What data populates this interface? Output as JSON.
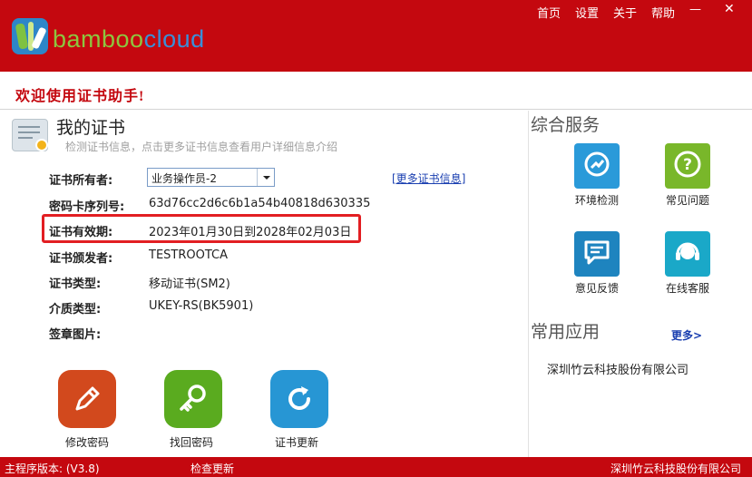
{
  "header": {
    "brand_part1": "bamboo",
    "brand_part2": "cloud",
    "menu": [
      "首页",
      "设置",
      "关于",
      "帮助"
    ],
    "minimize": "—",
    "close": "✕"
  },
  "welcome": "欢迎使用证书助手!",
  "cert": {
    "title": "我的证书",
    "desc": "检测证书信息，点击更多证书信息查看用户详细信息介绍",
    "more_link": "[更多证书信息]",
    "fields": [
      {
        "label": "证书所有者:",
        "value": "业务操作员-2"
      },
      {
        "label": "密码卡序列号:",
        "value": "63d76cc2d6c6b1a54b40818d630335"
      },
      {
        "label": "证书有效期:",
        "value": "2023年01月30日到2028年02月03日"
      },
      {
        "label": "证书颁发者:",
        "value": "TESTROOTCA"
      },
      {
        "label": "证书类型:",
        "value": "移动证书(SM2)"
      },
      {
        "label": "介质类型:",
        "value": "UKEY-RS(BK5901)"
      },
      {
        "label": "签章图片:",
        "value": ""
      }
    ]
  },
  "actions": [
    {
      "label": "修改密码",
      "icon": "pencil-icon",
      "color": "#d2491d"
    },
    {
      "label": "找回密码",
      "icon": "key-icon",
      "color": "#5aab1f"
    },
    {
      "label": "证书更新",
      "icon": "refresh-icon",
      "color": "#2796d4"
    }
  ],
  "services": {
    "title": "综合服务",
    "items": [
      {
        "label": "环境检测",
        "icon": "gauge-icon",
        "color": "#2a9ad9"
      },
      {
        "label": "常见问题",
        "icon": "question-icon",
        "color": "#79b72a"
      },
      {
        "label": "意见反馈",
        "icon": "chat-icon",
        "color": "#1e84bf"
      },
      {
        "label": "在线客服",
        "icon": "headset-icon",
        "color": "#1aa8c8"
      }
    ]
  },
  "apps": {
    "title": "常用应用",
    "more": "更多>",
    "company": "深圳竹云科技股份有限公司"
  },
  "footer": {
    "version": "主程序版本: (V3.8)",
    "check_update": "检查更新",
    "company": "深圳竹云科技股份有限公司"
  }
}
